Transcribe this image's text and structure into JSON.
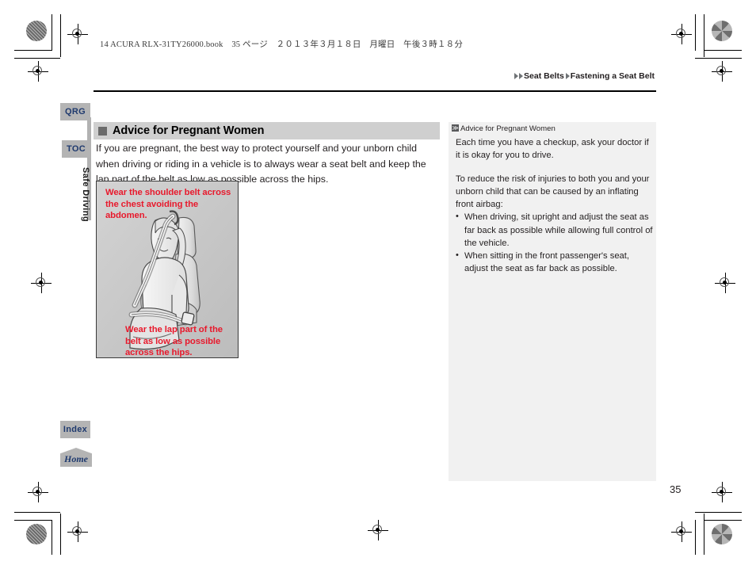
{
  "print": {
    "slug_line": "14 ACURA RLX-31TY26000.book　35 ページ　２０１３年３月１８日　月曜日　午後３時１８分"
  },
  "breadcrumb": {
    "arrow_glyph": "▶",
    "items": [
      "Seat Belts",
      "Fastening a Seat Belt"
    ]
  },
  "sidebar": {
    "tabs": [
      {
        "id": "qrg",
        "label": "QRG"
      },
      {
        "id": "toc",
        "label": "TOC"
      },
      {
        "id": "index",
        "label": "Index"
      }
    ],
    "vertical_label": "Safe Driving",
    "home_label": "Home"
  },
  "main": {
    "section_title": "Advice for Pregnant Women",
    "paragraph": "If you are pregnant, the best way to protect yourself and your unborn child when driving or riding in a vehicle is to always wear a seat belt and keep the lap part of the belt as low as possible across the hips.",
    "figure": {
      "caption_top": "Wear the shoulder belt across the chest avoiding the abdomen.",
      "caption_bottom": "Wear the lap part of the belt as low as possible across the hips.",
      "alt": "Illustration of a pregnant woman seated in a vehicle seat wearing the shoulder belt across the chest and the lap belt low across the hips"
    }
  },
  "info_panel": {
    "marker_glyph": "≫",
    "heading": "Advice for Pregnant Women",
    "paragraph_1": "Each time you have a checkup, ask your doctor if it is okay for you to drive.",
    "paragraph_2": "To reduce the risk of injuries to both you and your unborn child that can be caused by an inflating front airbag:",
    "bullets": [
      "When driving, sit upright and adjust the seat as far back as possible while allowing full control of the vehicle.",
      "When sitting in the front passenger's seat, adjust the seat as far back as possible."
    ]
  },
  "footer": {
    "page_number": "35"
  },
  "colors": {
    "tab_gray": "#b4b4b4",
    "tab_text_blue": "#1f3a6e",
    "section_bar_gray": "#cfcfcf",
    "info_panel_gray": "#f1f1f1",
    "caption_red": "#e8192c",
    "figure_bg": "#c9c9c9"
  }
}
